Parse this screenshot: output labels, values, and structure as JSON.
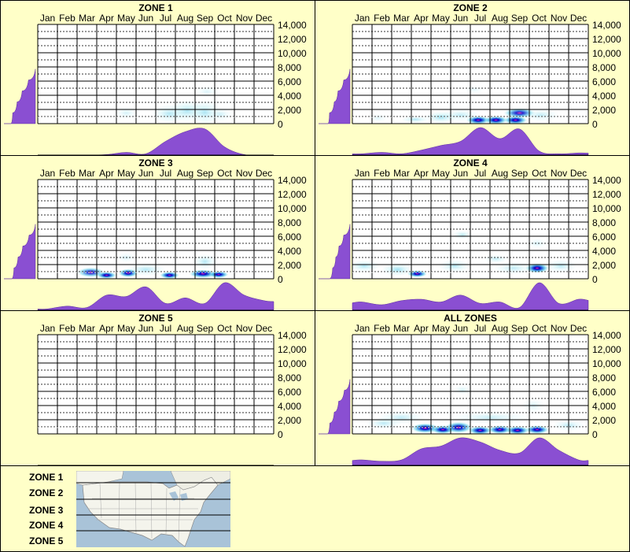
{
  "chart_data": {
    "type": "heatmap",
    "months": [
      "Jan",
      "Feb",
      "Mar",
      "Apr",
      "May",
      "Jun",
      "Jul",
      "Aug",
      "Sep",
      "Oct",
      "Nov",
      "Dec"
    ],
    "y_ticks": [
      "14,000",
      "12,000",
      "10,000",
      "8,000",
      "6,000",
      "4,000",
      "2,000",
      "0"
    ],
    "ylim": [
      0,
      14000
    ],
    "colors": {
      "fill": "#8a4fd2",
      "hot": "#ff2aa8",
      "deep": "#0000c8",
      "mid": "#1e6cd8",
      "light": "#48c6e6",
      "faint": "#b9eef6"
    },
    "panels": [
      {
        "title": "ZONE 1",
        "monthly": [
          0,
          0,
          0,
          0.02,
          0.1,
          0.05,
          0.5,
          0.85,
          0.95,
          0.3,
          0.02,
          0
        ],
        "elevation": [
          0.22,
          0.28,
          0.42,
          0.58,
          0.78,
          1.0
        ],
        "blobs": [
          {
            "m": 4.5,
            "e": 1500,
            "w": 0.6,
            "h": 900,
            "i": 0.3
          },
          {
            "m": 6.7,
            "e": 1400,
            "w": 0.9,
            "h": 1300,
            "i": 0.55
          },
          {
            "m": 7.6,
            "e": 1800,
            "w": 0.9,
            "h": 1500,
            "i": 0.6
          },
          {
            "m": 8.5,
            "e": 1600,
            "w": 0.8,
            "h": 1700,
            "i": 0.6
          },
          {
            "m": 8.6,
            "e": 4500,
            "w": 0.6,
            "h": 800,
            "i": 0.25
          },
          {
            "m": 9.3,
            "e": 1300,
            "w": 0.6,
            "h": 1000,
            "i": 0.35
          }
        ]
      },
      {
        "title": "ZONE 2",
        "monthly": [
          0.05,
          0.1,
          0.05,
          0.18,
          0.35,
          0.5,
          1.0,
          0.6,
          0.95,
          0.15,
          0.05,
          0.08
        ],
        "elevation": [
          0.3,
          0.35,
          0.5,
          0.62,
          0.8,
          1.0
        ],
        "blobs": [
          {
            "m": 1.3,
            "e": 800,
            "w": 0.5,
            "h": 600,
            "i": 0.25
          },
          {
            "m": 3.2,
            "e": 600,
            "w": 0.7,
            "h": 500,
            "i": 0.6
          },
          {
            "m": 4.5,
            "e": 900,
            "w": 0.8,
            "h": 800,
            "i": 0.75
          },
          {
            "m": 6.4,
            "e": 500,
            "w": 0.6,
            "h": 600,
            "i": 1.2
          },
          {
            "m": 7.3,
            "e": 500,
            "w": 0.6,
            "h": 600,
            "i": 1.1
          },
          {
            "m": 8.3,
            "e": 500,
            "w": 0.6,
            "h": 600,
            "i": 1.2
          },
          {
            "m": 8.5,
            "e": 1500,
            "w": 0.8,
            "h": 700,
            "i": 0.85
          },
          {
            "m": 9.6,
            "e": 1200,
            "w": 0.9,
            "h": 900,
            "i": 0.45
          },
          {
            "m": 6.2,
            "e": 4800,
            "w": 0.5,
            "h": 600,
            "i": 0.2
          },
          {
            "m": 5.5,
            "e": 1200,
            "w": 1.0,
            "h": 900,
            "i": 0.45
          }
        ]
      },
      {
        "title": "ZONE 3",
        "monthly": [
          0.05,
          0.15,
          0.1,
          0.55,
          0.5,
          0.85,
          0.25,
          0.45,
          0.25,
          1.0,
          0.55,
          0.35
        ],
        "elevation": [
          0.25,
          0.32,
          0.45,
          0.6,
          0.8,
          1.0
        ],
        "blobs": [
          {
            "m": 2.7,
            "e": 900,
            "w": 0.7,
            "h": 700,
            "i": 0.8
          },
          {
            "m": 3.5,
            "e": 500,
            "w": 0.5,
            "h": 500,
            "i": 1.1
          },
          {
            "m": 4.6,
            "e": 800,
            "w": 0.5,
            "h": 600,
            "i": 1.25
          },
          {
            "m": 6.7,
            "e": 500,
            "w": 0.5,
            "h": 500,
            "i": 1.2
          },
          {
            "m": 8.4,
            "e": 700,
            "w": 0.7,
            "h": 600,
            "i": 1.25
          },
          {
            "m": 9.2,
            "e": 600,
            "w": 0.5,
            "h": 500,
            "i": 1.1
          },
          {
            "m": 8.5,
            "e": 2400,
            "w": 0.6,
            "h": 1100,
            "i": 0.55
          },
          {
            "m": 5.5,
            "e": 1300,
            "w": 1.0,
            "h": 900,
            "i": 0.55
          },
          {
            "m": 4.5,
            "e": 3000,
            "w": 0.5,
            "h": 700,
            "i": 0.3
          }
        ]
      },
      {
        "title": "ZONE 4",
        "monthly": [
          0.3,
          0.2,
          0.35,
          0.4,
          0.3,
          0.55,
          0.25,
          0.3,
          0.1,
          1.0,
          0.25,
          0.4
        ],
        "elevation": [
          0.35,
          0.45,
          0.55,
          0.65,
          0.8,
          1.0
        ],
        "blobs": [
          {
            "m": 0.6,
            "e": 1800,
            "w": 0.8,
            "h": 800,
            "i": 0.6
          },
          {
            "m": 2.3,
            "e": 1300,
            "w": 0.8,
            "h": 900,
            "i": 0.7
          },
          {
            "m": 3.3,
            "e": 700,
            "w": 0.5,
            "h": 500,
            "i": 1.1
          },
          {
            "m": 5.6,
            "e": 6200,
            "w": 0.5,
            "h": 600,
            "i": 0.5
          },
          {
            "m": 5.2,
            "e": 1800,
            "w": 0.8,
            "h": 900,
            "i": 0.55
          },
          {
            "m": 7.3,
            "e": 2800,
            "w": 0.6,
            "h": 600,
            "i": 0.45
          },
          {
            "m": 9.4,
            "e": 1500,
            "w": 0.6,
            "h": 700,
            "i": 1.25
          },
          {
            "m": 9.4,
            "e": 5000,
            "w": 0.5,
            "h": 700,
            "i": 0.3
          },
          {
            "m": 10.6,
            "e": 1800,
            "w": 0.8,
            "h": 900,
            "i": 0.5
          },
          {
            "m": 8.2,
            "e": 1500,
            "w": 1.0,
            "h": 900,
            "i": 0.45
          }
        ]
      },
      {
        "title": "ZONE 5",
        "monthly": [],
        "elevation": [],
        "blobs": []
      },
      {
        "title": "ALL ZONES",
        "monthly": [
          0.2,
          0.15,
          0.2,
          0.6,
          0.7,
          1.0,
          0.85,
          0.55,
          0.45,
          1.0,
          0.55,
          0.2
        ],
        "elevation": [
          0.28,
          0.36,
          0.5,
          0.64,
          0.82,
          1.0
        ],
        "blobs": [
          {
            "m": 1.6,
            "e": 1500,
            "w": 0.9,
            "h": 800,
            "i": 0.5
          },
          {
            "m": 3.7,
            "e": 800,
            "w": 0.7,
            "h": 700,
            "i": 1.0
          },
          {
            "m": 4.6,
            "e": 600,
            "w": 0.6,
            "h": 600,
            "i": 1.2
          },
          {
            "m": 5.4,
            "e": 900,
            "w": 0.7,
            "h": 800,
            "i": 0.95
          },
          {
            "m": 6.5,
            "e": 500,
            "w": 0.6,
            "h": 600,
            "i": 1.2
          },
          {
            "m": 7.5,
            "e": 600,
            "w": 0.6,
            "h": 600,
            "i": 1.1
          },
          {
            "m": 8.4,
            "e": 500,
            "w": 0.6,
            "h": 600,
            "i": 1.25
          },
          {
            "m": 9.4,
            "e": 600,
            "w": 0.6,
            "h": 600,
            "i": 1.2
          },
          {
            "m": 5.6,
            "e": 6200,
            "w": 0.5,
            "h": 700,
            "i": 0.3
          },
          {
            "m": 9.2,
            "e": 4000,
            "w": 0.6,
            "h": 1000,
            "i": 0.3
          },
          {
            "m": 2.5,
            "e": 2300,
            "w": 1.2,
            "h": 900,
            "i": 0.45
          },
          {
            "m": 7.0,
            "e": 2300,
            "w": 2.0,
            "h": 900,
            "i": 0.4
          },
          {
            "m": 11.0,
            "e": 1200,
            "w": 0.8,
            "h": 800,
            "i": 0.5
          }
        ]
      }
    ]
  },
  "legend": {
    "zones": [
      "ZONE 1",
      "ZONE 2",
      "ZONE 3",
      "ZONE 4",
      "ZONE 5"
    ]
  }
}
